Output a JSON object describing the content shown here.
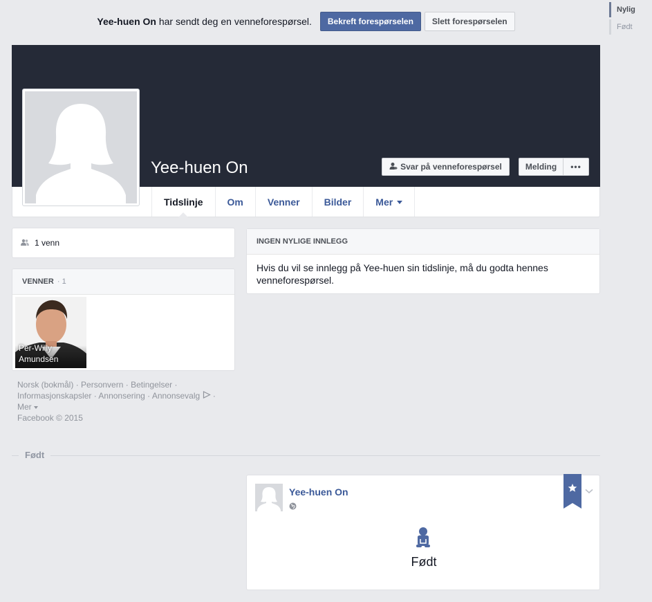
{
  "friend_request": {
    "name": "Yee-huen On",
    "message": " har sendt deg en venneforespørsel.",
    "confirm_label": "Bekreft forespørselen",
    "delete_label": "Slett forespørselen"
  },
  "scrubber": {
    "items": [
      {
        "label": "Nylig"
      },
      {
        "label": "Født"
      }
    ]
  },
  "profile": {
    "name": "Yee-huen On",
    "respond_label": "Svar på venneforespørsel",
    "message_label": "Melding",
    "more_label": "•••"
  },
  "tabs": [
    {
      "label": "Tidslinje"
    },
    {
      "label": "Om"
    },
    {
      "label": "Venner"
    },
    {
      "label": "Bilder"
    },
    {
      "label": "Mer"
    }
  ],
  "friends_count": "1 venn",
  "friends_box": {
    "title": "VENNER",
    "count": "· 1",
    "friends": [
      {
        "name": "Per-Willy Amundsen"
      }
    ]
  },
  "footer": {
    "links": [
      "Norsk (bokmål)",
      "Personvern",
      "Betingelser",
      "Informasjonskapsler",
      "Annonsering",
      "Annonsevalg",
      "Mer"
    ],
    "copyright": "Facebook © 2015"
  },
  "posts": {
    "header": "INGEN NYLIGE INNLEGG",
    "body": "Hvis du vil se innlegg på Yee-huen sin tidslinje, må du godta hennes venneforespørsel."
  },
  "section_label": "Født",
  "born_card": {
    "author": "Yee-huen On",
    "title": "Født"
  },
  "colors": {
    "brand_blue": "#4e69a2",
    "link_blue": "#3b5998",
    "cover_dark": "#252a37",
    "page_bg": "#e9eaed"
  }
}
